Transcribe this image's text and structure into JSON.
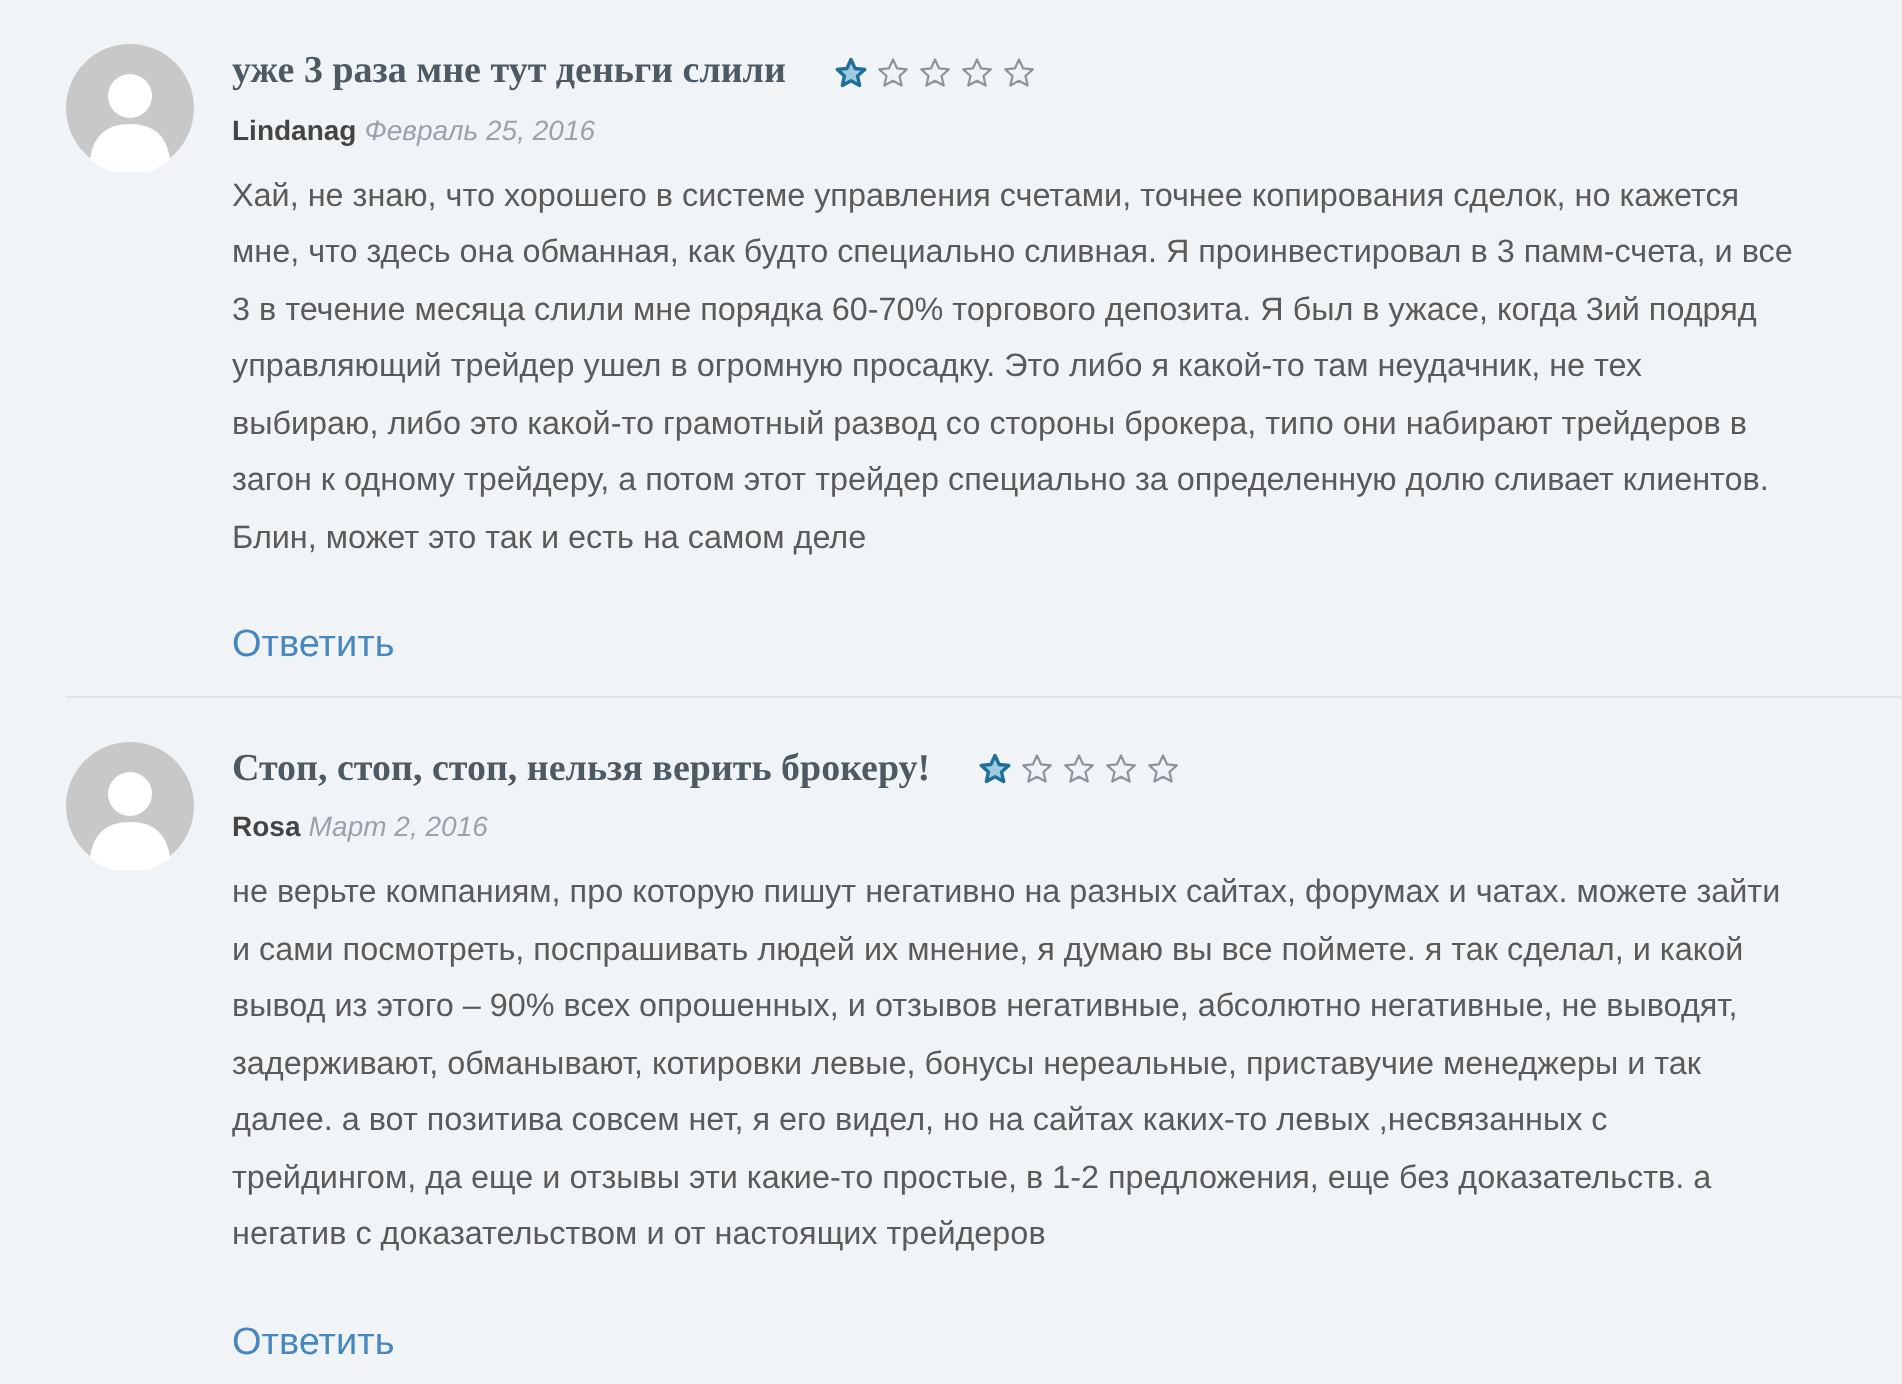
{
  "comments": [
    {
      "title": "уже 3 раза мне тут деньги слили",
      "stars": 1,
      "author": "Lindanag",
      "date": "Февраль 25, 2016",
      "text": "Хай, не знаю, что хорошего в системе управления счетами, точнее копирования сделок, но кажется мне, что здесь она обманная, как будто специально сливная. Я проинвестировал в 3 памм-счета, и все 3 в течение месяца слили мне порядка 60-70% торгового депозита. Я был в ужасе, когда 3ий подряд управляющий трейдер ушел в огромную просадку. Это либо я какой-то там неудачник, не тех выбираю, либо это какой-то грамотный развод со стороны брокера, типо они набирают трейдеров в загон к одному трейдеру, а потом этот трейдер специально за определенную долю сливает клиентов. Блин, может это так и есть на самом деле",
      "reply": "Ответить"
    },
    {
      "title": "Стоп, стоп, стоп, нельзя верить брокеру!",
      "stars": 1,
      "author": "Rosa",
      "date": "Март 2, 2016",
      "text": "не верьте компаниям, про которую пишут негативно на разных сайтах, форумах и чатах. можете зайти и сами посмотреть, поспрашивать людей их мнение, я думаю вы все поймете. я так сделал, и какой вывод из этого – 90% всех опрошенных, и отзывов негативные, абсолютно негативные, не выводят, задерживают, обманывают, котировки левые, бонусы нереальные, приставучие менеджеры и так далее. а вот позитива совсем нет, я его видел, но на сайтах каких-то левых ,несвязанных с трейдингом, да еще и отзывы эти какие-то простые, в 1-2 предложения, еще без доказательств. а негатив с доказательством и от настоящих трейдеров",
      "reply": "Ответить"
    }
  ]
}
